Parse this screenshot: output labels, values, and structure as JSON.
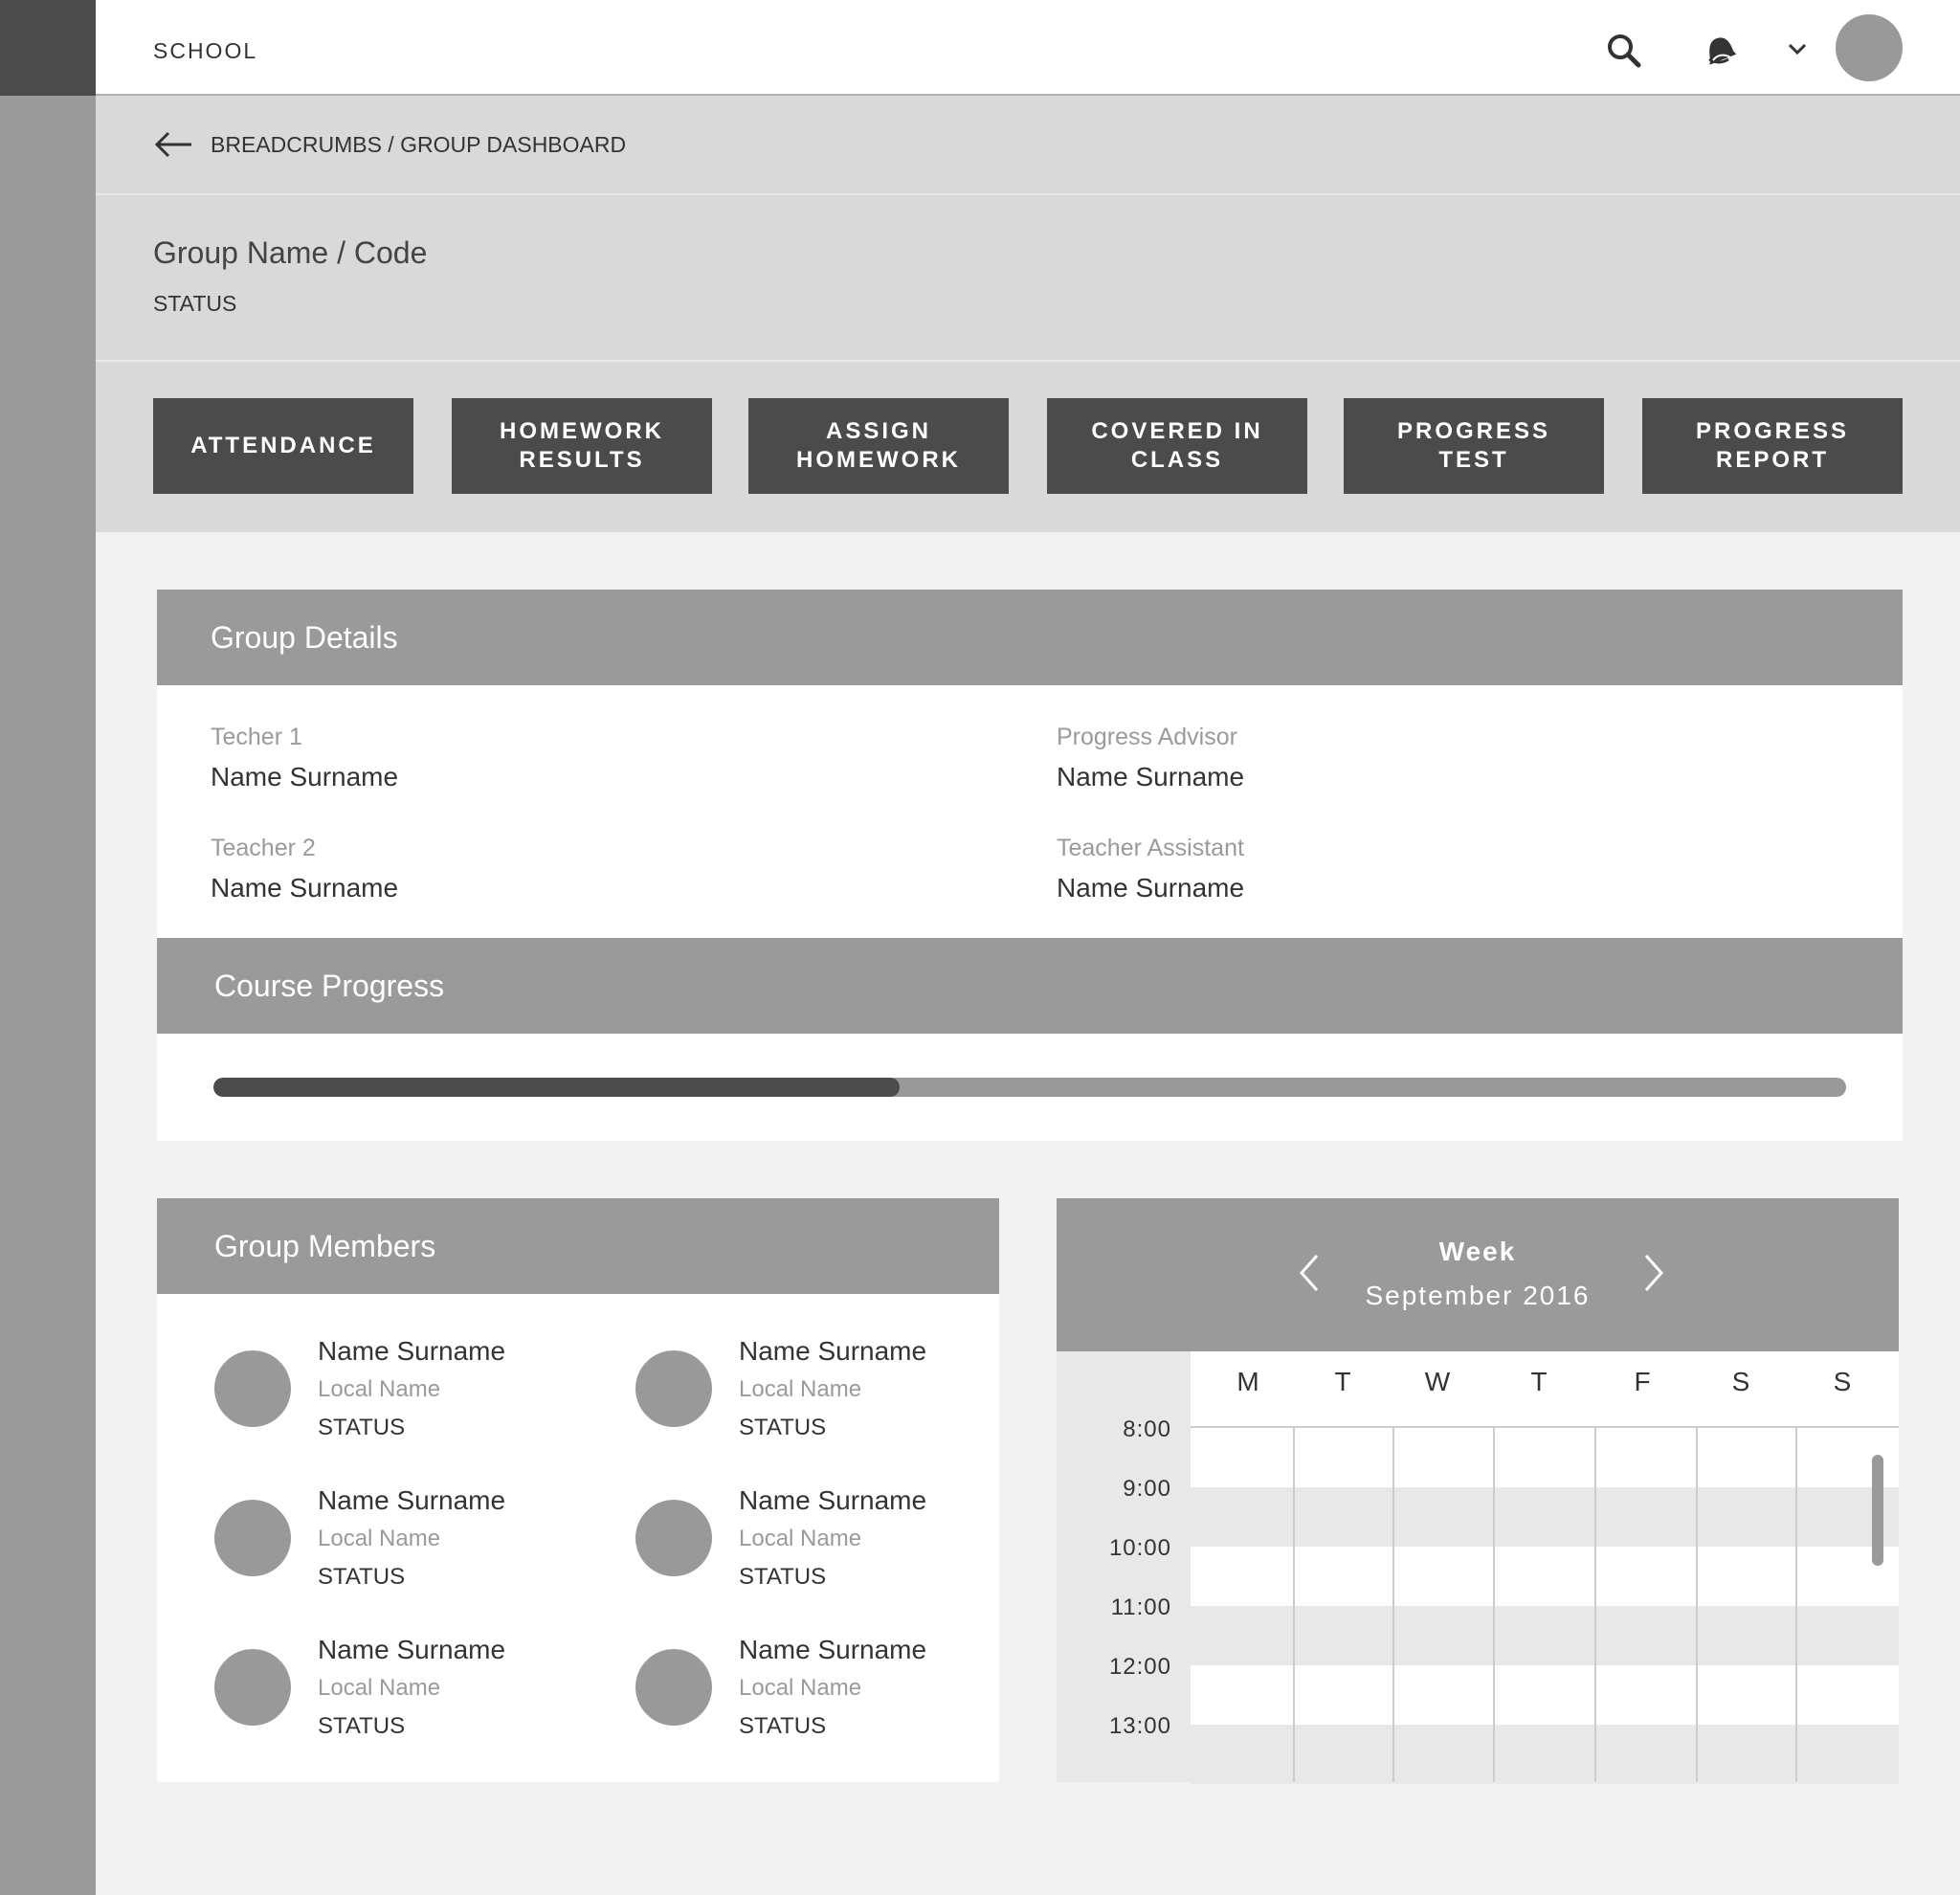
{
  "app": {
    "brand": "SCHOOL"
  },
  "breadcrumb": {
    "text": "BREADCRUMBS / GROUP DASHBOARD"
  },
  "group": {
    "title": "Group Name / Code",
    "status": "STATUS"
  },
  "tabs": [
    {
      "label": "ATTENDANCE"
    },
    {
      "label": "HOMEWORK\nRESULTS"
    },
    {
      "label": "ASSIGN\nHOMEWORK"
    },
    {
      "label": "COVERED IN\nCLASS"
    },
    {
      "label": "PROGRESS\nTEST"
    },
    {
      "label": "PROGRESS\nREPORT"
    }
  ],
  "group_details": {
    "title": "Group Details",
    "fields": [
      {
        "label": "Techer 1",
        "value": "Name Surname"
      },
      {
        "label": "Progress Advisor",
        "value": "Name Surname"
      },
      {
        "label": "Teacher 2",
        "value": "Name Surname"
      },
      {
        "label": "Teacher Assistant",
        "value": "Name Surname"
      }
    ]
  },
  "course_progress": {
    "title": "Course Progress",
    "percent": 42
  },
  "group_members": {
    "title": "Group Members",
    "members": [
      {
        "name": "Name Surname",
        "local": "Local Name",
        "status": "STATUS"
      },
      {
        "name": "Name Surname",
        "local": "Local Name",
        "status": "STATUS"
      },
      {
        "name": "Name Surname",
        "local": "Local Name",
        "status": "STATUS"
      },
      {
        "name": "Name Surname",
        "local": "Local Name",
        "status": "STATUS"
      },
      {
        "name": "Name Surname",
        "local": "Local Name",
        "status": "STATUS"
      },
      {
        "name": "Name Surname",
        "local": "Local Name",
        "status": "STATUS"
      }
    ]
  },
  "calendar": {
    "view": "Week",
    "month": "September 2016",
    "days": [
      "M",
      "T",
      "W",
      "T",
      "F",
      "S",
      "S"
    ],
    "times": [
      "8:00",
      "9:00",
      "10:00",
      "11:00",
      "12:00",
      "13:00"
    ]
  },
  "icons": {
    "search": "search-icon",
    "notifications": "bell-icon",
    "menu": "chevron-down-icon",
    "back": "arrow-left-icon",
    "prev": "chevron-left-icon",
    "next": "chevron-right-icon"
  }
}
